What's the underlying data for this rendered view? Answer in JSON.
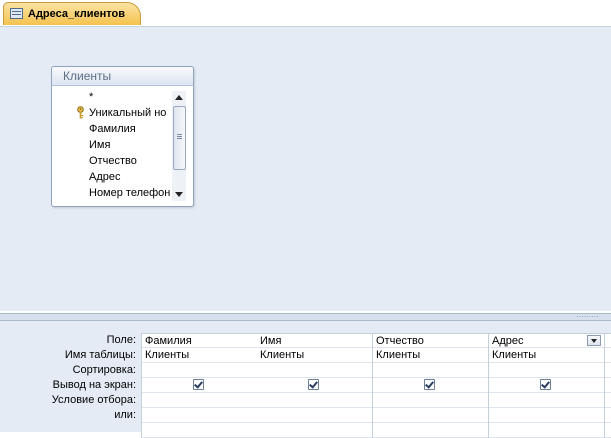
{
  "document_tab": {
    "title": "Адреса_клиентов",
    "icon": "query-icon"
  },
  "table_window": {
    "title": "Клиенты",
    "fields": [
      "*",
      "Уникальный но",
      "Фамилия",
      "Имя",
      "Отчество",
      "Адрес",
      "Номер телефон"
    ],
    "primary_key_icon": "key-icon"
  },
  "grid": {
    "row_labels": [
      "Поле:",
      "Имя таблицы:",
      "Сортировка:",
      "Вывод на экран:",
      "Условие отбора:",
      "или:"
    ],
    "columns": [
      {
        "field": "Фамилия",
        "table": "Клиенты",
        "sort": "",
        "show": true,
        "criteria": "",
        "or": ""
      },
      {
        "field": "Имя",
        "table": "Клиенты",
        "sort": "",
        "show": true,
        "criteria": "",
        "or": ""
      },
      {
        "field": "Отчество",
        "table": "Клиенты",
        "sort": "",
        "show": true,
        "criteria": "",
        "or": ""
      },
      {
        "field": "Адрес",
        "table": "Клиенты",
        "sort": "",
        "show": true,
        "criteria": "",
        "or": ""
      }
    ]
  },
  "splitter_dots": "·········",
  "colors": {
    "tab_accent": "#f5c24e",
    "background": "#e4ebf5"
  }
}
